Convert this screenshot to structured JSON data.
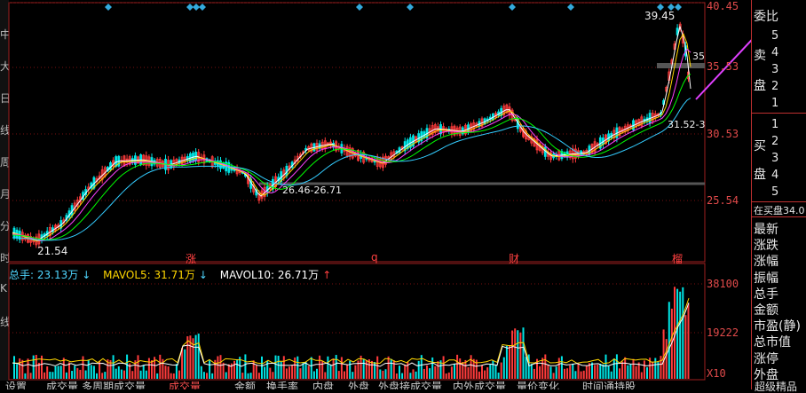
{
  "price_axis": [
    "40.45",
    "35.53",
    "30.53",
    "25.54"
  ],
  "volume_axis": [
    "38100",
    "19222",
    "X10"
  ],
  "annotations": {
    "high": "39.45",
    "low": "21.54",
    "range_label": "26.46-26.71",
    "right_range": "31.52-3",
    "right_price_cut": "35"
  },
  "event_markers": [
    "涨",
    "q",
    "财",
    "榴"
  ],
  "volume_legend": {
    "total": "总手: 23.13万",
    "total_arrow": "↓",
    "mavol5": "MAVOL5: 31.71万",
    "mavol5_arrow": "↓",
    "mavol10": "MAVOL10: 26.71万",
    "mavol10_arrow": "↑"
  },
  "order_book": {
    "header": "委比",
    "sell_label_1": "卖",
    "sell_label_2": "盘",
    "sell_levels": [
      "5",
      "4",
      "3",
      "2",
      "1"
    ],
    "buy_label_1": "买",
    "buy_label_2": "盘",
    "buy_levels": [
      "1",
      "2",
      "3",
      "4",
      "5"
    ],
    "pending_buy": "在买盘34.0"
  },
  "stats_labels": [
    "最新",
    "涨跌",
    "涨幅",
    "振幅",
    "总手",
    "金额",
    "市盈(静)",
    "总市值",
    "涨停",
    "外盘"
  ],
  "tabs": [
    "设置",
    "成交量",
    "多周期成交量",
    "成交量",
    "金额",
    "换手率",
    "内盘",
    "外盘",
    "外盘接成交量",
    "内外成交量",
    "量价变化",
    "时间通持股"
  ],
  "active_tab_index": 3,
  "bottom_right_label": "超级精品",
  "left_strip_chars": [
    "中",
    "大",
    "日",
    "线",
    "周",
    "月",
    "分",
    "时",
    "K",
    "线"
  ],
  "colors": {
    "up": "#ff3b3b",
    "down": "#00e5e5",
    "axis": "#e04a4a",
    "ma5": "#ffffff",
    "ma10": "#ffd700",
    "ma20": "#ff40ff",
    "ma30": "#00ff00",
    "ma60": "#33ccff",
    "trend_arrow": "#e040ff",
    "diamond": "#33aadd"
  }
}
